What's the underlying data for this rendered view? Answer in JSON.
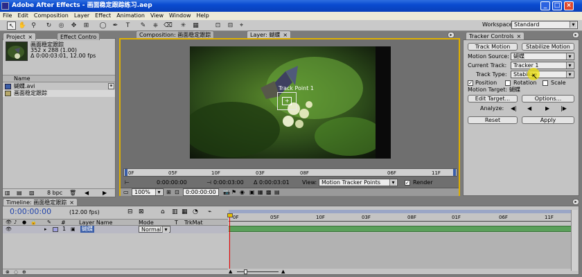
{
  "app": {
    "title": "Adobe After Effects - 画面稳定跟踪练习.aep",
    "menu": [
      "File",
      "Edit",
      "Composition",
      "Layer",
      "Effect",
      "Animation",
      "View",
      "Window",
      "Help"
    ],
    "workspace_label": "Workspace:",
    "workspace_value": "Standard"
  },
  "project": {
    "tab_project": "Project",
    "tab_effects": "Effect Contro",
    "item_name": "画面稳定跟踪",
    "item_size": "352 x 288 (1.00)",
    "item_duration": "Δ 0:00:03:01, 12.00 fps",
    "col_name": "Name",
    "items": [
      "蝴蝶.avi",
      "画面稳定跟踪"
    ],
    "bpc": "8 bpc"
  },
  "viewer": {
    "tab_comp": "Composition: 画面稳定跟踪",
    "tab_layer": "Layer: 蝴蝶",
    "track_point_label": "Track Point 1",
    "ruler_labels": [
      "0F",
      "05F",
      "10F",
      "03F",
      "08F",
      "06F",
      "11F"
    ],
    "time_start": "0:00:00:00",
    "time_end": "0:00:03:00",
    "time_duration": "Δ 0:00:03:01",
    "view_label": "View:",
    "view_value": "Motion Tracker Points",
    "render_label": "Render",
    "zoom": "100%",
    "current_time": "0:00:00:00"
  },
  "tracker": {
    "tab": "Tracker Controls",
    "track_motion": "Track Motion",
    "stabilize_motion": "Stabilize Motion",
    "motion_source_label": "Motion Source:",
    "motion_source_value": "蝴蝶",
    "current_track_label": "Current Track:",
    "current_track_value": "Tracker 1",
    "track_type_label": "Track Type:",
    "track_type_value": "Stabilize",
    "position_label": "Position",
    "rotation_label": "Rotation",
    "scale_label": "Scale",
    "motion_target_label": "Motion Target:",
    "motion_target_value": "蝴蝶",
    "edit_target": "Edit Target...",
    "options": "Options...",
    "analyze_label": "Analyze:",
    "reset": "Reset",
    "apply": "Apply"
  },
  "timeline": {
    "tab": "Timeline: 画面稳定跟踪",
    "current_time": "0:00:00:00",
    "fps": "(12.00 fps)",
    "col_layer_name": "Layer Name",
    "col_mode": "Mode",
    "col_t": "T",
    "col_trkmat": "TrkMat",
    "col_hash": "#",
    "layer_index": "1",
    "layer_name": "蝴蝶",
    "layer_mode": "Normal",
    "ruler_labels": [
      "0F",
      "05F",
      "10F",
      "03F",
      "08F",
      "01F",
      "06F",
      "11F"
    ]
  }
}
